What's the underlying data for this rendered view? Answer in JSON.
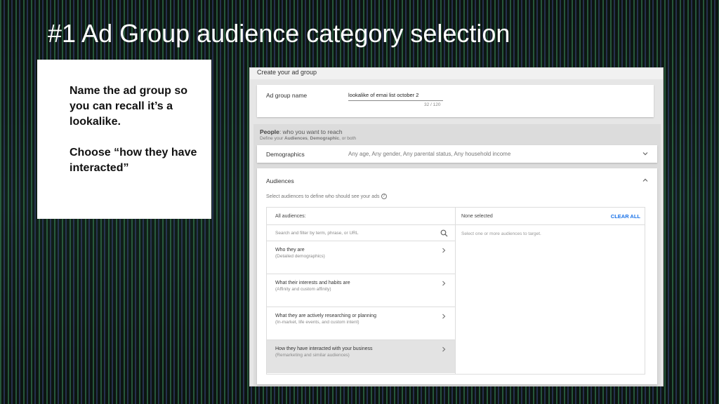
{
  "slide": {
    "title": "#1 Ad Group audience category selection"
  },
  "note": {
    "paragraph_1": "Name the ad group so you can recall it’s a lookalike.",
    "paragraph_2": "Choose “how they have interacted”"
  },
  "screenshot": {
    "header": "Create your ad group",
    "ad_group_name": {
      "label": "Ad group name",
      "value": "lookalike of emai list october 2",
      "counter": "32 / 120"
    },
    "people": {
      "title_bold": "People",
      "title_rest": ": who you want to reach",
      "subtitle_prefix": "Define your ",
      "subtitle_audiences": "Audiences",
      "subtitle_sep": ", ",
      "subtitle_demographic": "Demographic",
      "subtitle_suffix": ", or both"
    },
    "demographics": {
      "label": "Demographics",
      "value": "Any age, Any gender, Any parental status, Any household income",
      "chevron": "expand-icon"
    },
    "audiences": {
      "label": "Audiences",
      "subtitle": "Select audiences to define who should see your ads",
      "all_audiences_label": "All audiences:",
      "search_placeholder": "Search and filter by term, phrase, or URL",
      "categories": [
        {
          "title": "Who they are",
          "subtitle": "(Detailed demographics)"
        },
        {
          "title": "What their interests and habits are",
          "subtitle": "(Affinity and custom affinity)"
        },
        {
          "title": "What they are actively researching or planning",
          "subtitle": "(In-market, life events, and custom intent)"
        },
        {
          "title": "How they have interacted with your business",
          "subtitle": "(Remarketing and similar audiences)"
        }
      ],
      "selected_index": 3,
      "none_selected": "None selected",
      "clear_all": "CLEAR ALL",
      "right_hint": "Select one or more audiences to target."
    }
  },
  "colors": {
    "accent_link": "#1a73e8",
    "selected_row": "#e3e3e3"
  }
}
